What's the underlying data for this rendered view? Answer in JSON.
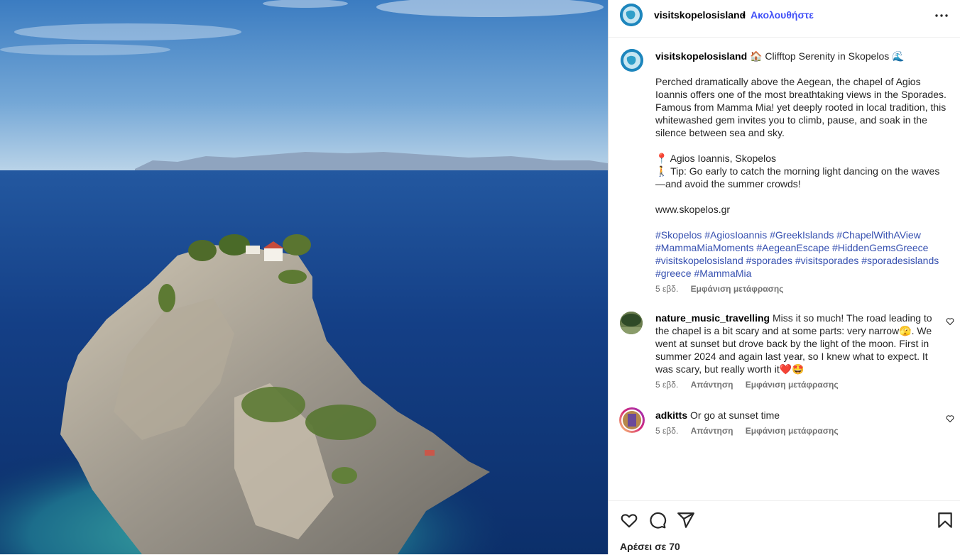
{
  "header": {
    "username": "visitskopelosisland",
    "dot": "•",
    "follow_label": "Ακολουθήστε",
    "more_icon": "more-horizontal-icon"
  },
  "caption": {
    "username": "visitskopelosisland",
    "title_icon_left": "🏠",
    "title": "Clifftop Serenity in Skopelos",
    "title_icon_right": "🌊",
    "paragraph": "Perched dramatically above the Aegean, the chapel of Agios Ioannis offers one of the most breathtaking views in the Sporades. Famous from Mamma Mia! yet deeply rooted in local tradition, this whitewashed gem invites you to climb, pause, and soak in the silence between sea and sky.",
    "location_icon": "📍",
    "location": "Agios Ioannis, Skopelos",
    "tip_icon": "🚶",
    "tip": "Tip: Go early to catch the morning light dancing on the waves—and avoid the summer crowds!",
    "website": "www.skopelos.gr",
    "hashtags": "#Skopelos #AgiosIoannis #GreekIslands #ChapelWithAView #MammaMiaMoments #AegeanEscape #HiddenGemsGreece #visitskopelosisland #sporades #visitsporades #sporadesislands #greece #MammaMia",
    "time": "5 εβδ.",
    "translate": "Εμφάνιση μετάφρασης"
  },
  "comments": [
    {
      "username": "nature_music_travelling",
      "text": "Miss it so much! The road leading to the chapel is a bit scary and at some parts: very narrow🫣. We went at sunset but drove back by the light of the moon. First in summer 2024 and again last year, so I knew what to expect. It was scary, but really worth it❤️🤩",
      "time": "5 εβδ.",
      "reply": "Απάντηση",
      "translate": "Εμφάνιση μετάφρασης"
    },
    {
      "username": "adkitts",
      "text": "Or go at sunset time",
      "time": "5 εβδ.",
      "reply": "Απάντηση",
      "translate": "Εμφάνιση μετάφρασης"
    }
  ],
  "actions": {
    "icons": [
      "heart-icon",
      "comment-icon",
      "share-icon",
      "bookmark-icon"
    ],
    "likes": "Αρέσει σε 70"
  }
}
